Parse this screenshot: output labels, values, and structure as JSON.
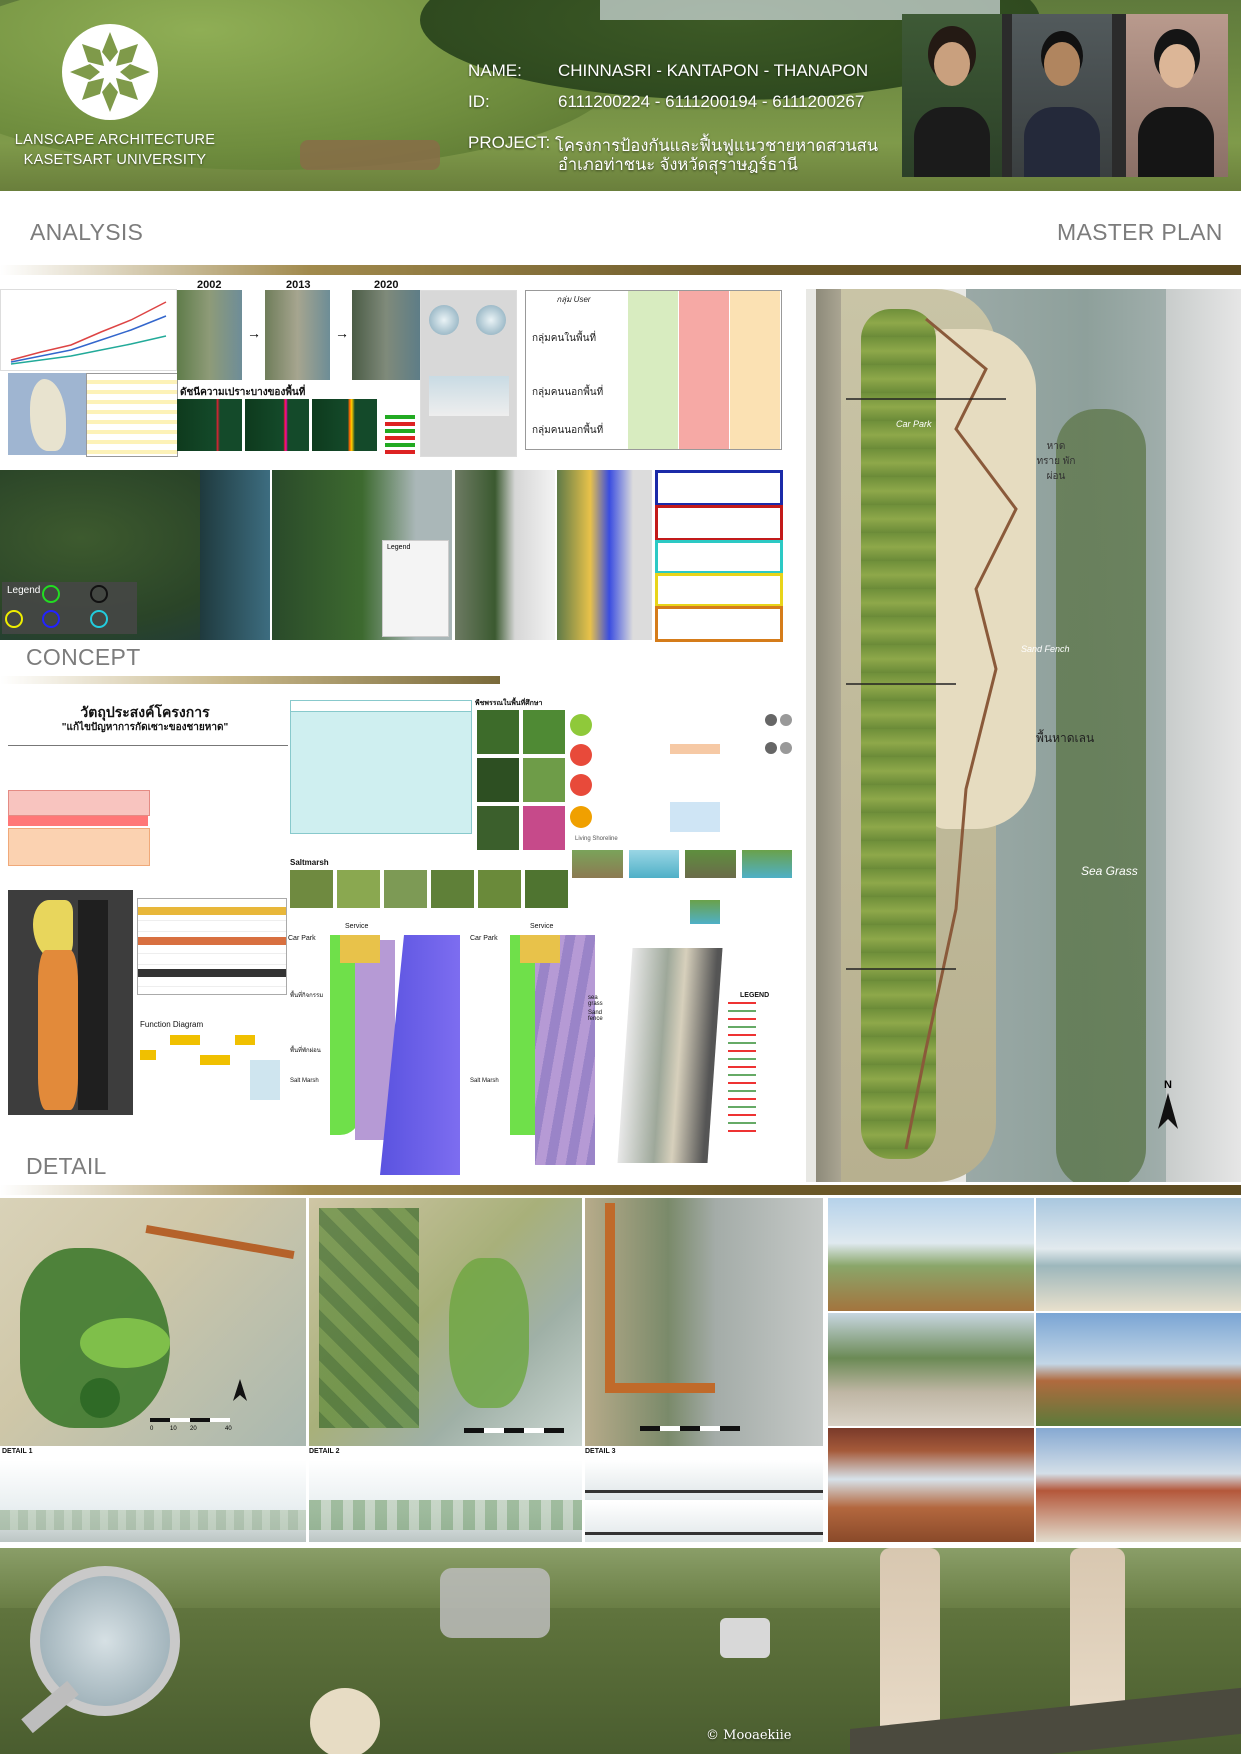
{
  "header": {
    "university_line1": "LANSCAPE ARCHITECTURE",
    "university_line2": "KASETSART UNIVERSITY",
    "name_label": "NAME:",
    "name_value": "CHINNASRI - KANTAPON - THANAPON",
    "id_label": "ID:",
    "id_value": "6111200224 - 6111200194 - 6111200267",
    "project_label": "PROJECT:",
    "project_line1": "โครงการป้องกันและฟื้นฟูแนวชายหาดสวนสน",
    "project_line2": "อำเภอท่าชนะ จังหวัดสุราษฎร์ธานี"
  },
  "sections": {
    "analysis": "ANALYSIS",
    "master_plan": "MASTER PLAN",
    "concept": "CONCEPT",
    "detail": "DETAIL"
  },
  "analysis": {
    "years": [
      "2002",
      "2013",
      "2020"
    ],
    "vulnerability_title": "ดัชนีความเปราะบางของพื้นที่",
    "user_header": "กลุ่ม User",
    "user_groups": [
      "กลุ่มคนในพื้นที่",
      "กลุ่มคนนอกพื้นที่",
      "กลุ่มคนนอกพื้นที่"
    ],
    "legend_title": "Legend",
    "land_legend_title": "Legend"
  },
  "concept": {
    "objective_title": "วัตถุประสงค์โครงการ",
    "objective_quote": "\"แก้ไขปัญหาการกัดเซาะของชายหาด\"",
    "species_title": "พืชพรรณในพื้นที่ศึกษา",
    "saltmarsh_label": "Saltmarsh",
    "living_shoreline": "Living Shoreline",
    "function_diagram": "Function Diagram",
    "legend": "LEGEND",
    "zone_labels_left": [
      "Car Park",
      "Service",
      "พื้นที่กิจกรรม",
      "พื้นที่พักผ่อน",
      "Salt Marsh"
    ],
    "zone_labels_right": [
      "Car Park",
      "Service",
      "sea grass",
      "Sand fence",
      "Salt Marsh"
    ]
  },
  "master_plan": {
    "labels": [
      "Car Park",
      "หาดทราย พักผ่อน",
      "Sand Fench",
      "พื้นหาดเลน",
      "Sea Grass"
    ],
    "north": "N"
  },
  "details": {
    "labels": [
      "DETAIL 1",
      "DETAIL 2",
      "DETAIL 3"
    ],
    "scale_numbers": [
      "0",
      "10",
      "20",
      "40"
    ]
  },
  "footer": {
    "copyright": "© Mooaekiie"
  }
}
